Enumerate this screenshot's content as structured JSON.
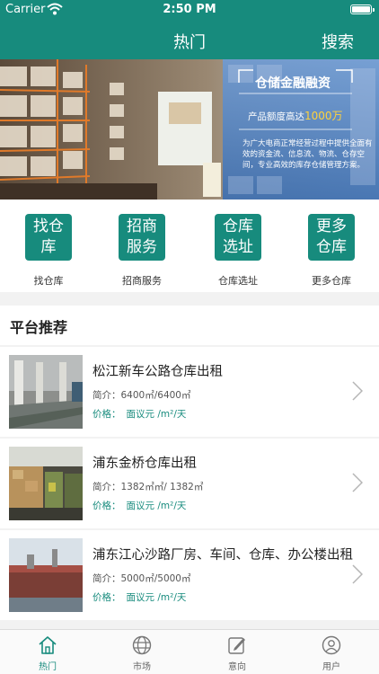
{
  "status_bar": {
    "carrier": "Carrier",
    "time": "2:50 PM"
  },
  "nav": {
    "title": "热门",
    "search_label": "搜索"
  },
  "banner": {
    "title": "仓储金融融资",
    "subtitle_prefix": "产品额度高达",
    "subtitle_amount": "1000万",
    "description": "为广大电商正常经营过程中提供全面有效的资金流、信息流、物流、仓存空间，专业高效的库存仓储管理方案。"
  },
  "quick_links": [
    {
      "tile_line1": "找仓",
      "tile_line2": "库",
      "caption": "找仓库"
    },
    {
      "tile_line1": "招商",
      "tile_line2": "服务",
      "caption": "招商服务"
    },
    {
      "tile_line1": "仓库",
      "tile_line2": "选址",
      "caption": "仓库选址"
    },
    {
      "tile_line1": "更多",
      "tile_line2": "仓库",
      "caption": "更多仓库"
    }
  ],
  "section": {
    "title": "平台推荐"
  },
  "listings": [
    {
      "title": "松江新车公路仓库出租",
      "intro": "简介：6400㎡/6400㎡",
      "price_label": "价格：",
      "price_value": "面议元 /m²/天"
    },
    {
      "title": "浦东金桥仓库出租",
      "intro": "简介：1382㎡㎡/ 1382㎡",
      "price_label": "价格：",
      "price_value": "面议元 /m²/天"
    },
    {
      "title": "浦东江心沙路厂房、车间、仓库、办公楼出租",
      "intro": "简介：5000㎡/5000㎡",
      "price_label": "价格：",
      "price_value": "面议元 /m²/天"
    }
  ],
  "tab_bar": [
    {
      "label": "热门",
      "icon": "home-icon",
      "active": true
    },
    {
      "label": "市场",
      "icon": "globe-icon",
      "active": false
    },
    {
      "label": "意向",
      "icon": "edit-icon",
      "active": false
    },
    {
      "label": "用户",
      "icon": "user-icon",
      "active": false
    }
  ],
  "colors": {
    "primary": "#178b7d",
    "highlight": "#ffd23c"
  }
}
